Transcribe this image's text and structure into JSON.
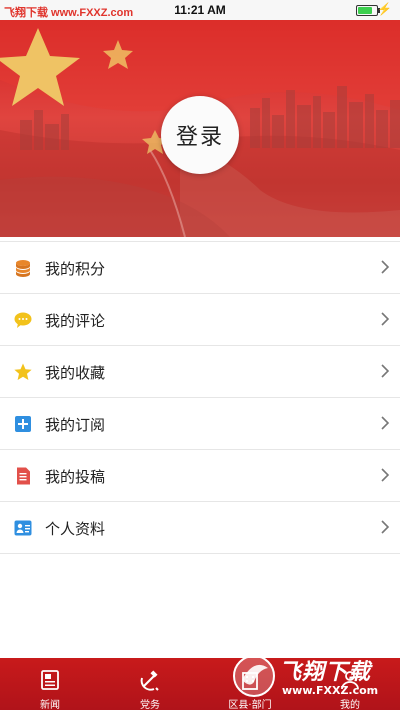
{
  "status_bar": {
    "watermark": "飞翔下载 www.FXXZ.com",
    "time": "11:21 AM",
    "battery_level": 0.8
  },
  "header": {
    "login_label": "登录"
  },
  "menu": {
    "items": [
      {
        "label": "我的积分",
        "icon": "coins-icon"
      },
      {
        "label": "我的评论",
        "icon": "comment-bubble-icon"
      },
      {
        "label": "我的收藏",
        "icon": "star-icon"
      },
      {
        "label": "我的订阅",
        "icon": "plus-square-icon"
      },
      {
        "label": "我的投稿",
        "icon": "document-icon"
      },
      {
        "label": "个人资料",
        "icon": "profile-card-icon"
      }
    ]
  },
  "tabbar": {
    "tabs": [
      {
        "label": "新闻",
        "icon": "newspaper-icon"
      },
      {
        "label": "党务",
        "icon": "hammer-sickle-icon"
      },
      {
        "label": "区县·部门",
        "icon": "building-icon"
      },
      {
        "label": "我的",
        "icon": "person-icon"
      }
    ]
  },
  "watermark_logo": {
    "title": "飞翔下载",
    "url": "www.FXXZ.com"
  },
  "colors": {
    "header_red": "#d21f20",
    "tabbar_red": "#c81a1b",
    "coins": "#e8862a",
    "comment": "#f2c21b",
    "star": "#f2c21b",
    "subscribe": "#2f8fe0",
    "contribute": "#e2504a",
    "profile": "#2f8fe0"
  }
}
